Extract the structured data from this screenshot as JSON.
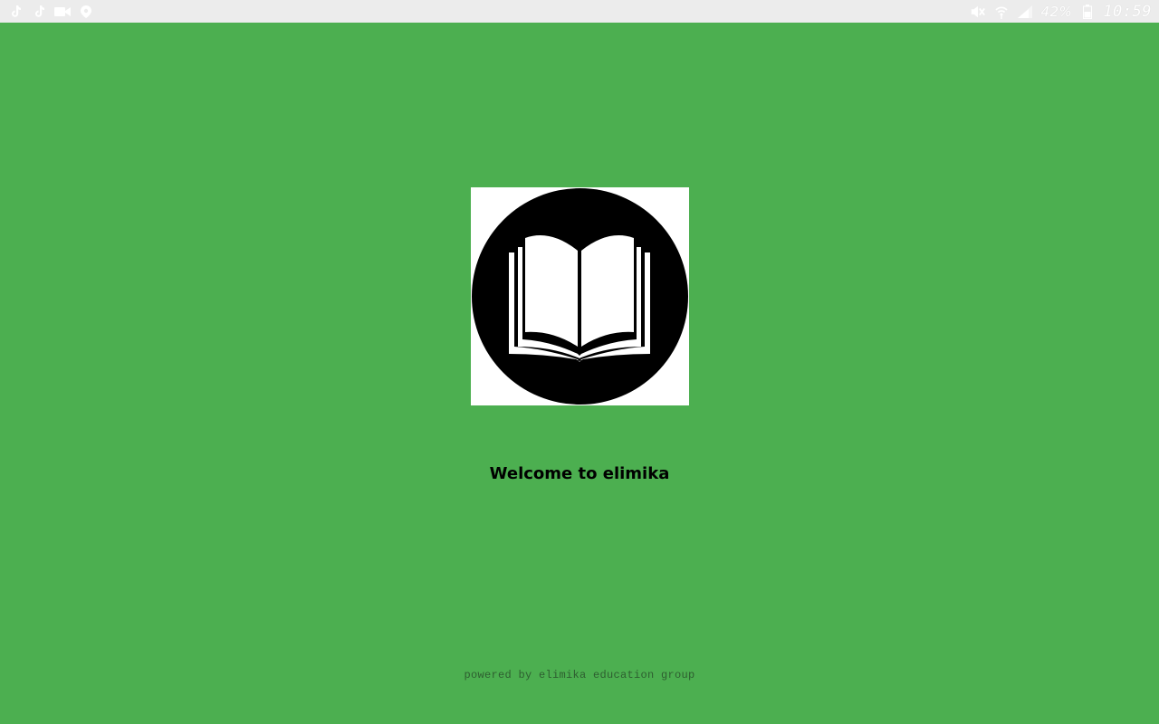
{
  "status_bar": {
    "left_icons": [
      "tiktok-icon",
      "tiktok-icon",
      "video-camera-icon",
      "location-pin-icon"
    ],
    "right_icons": [
      "mute-icon",
      "wifi-icon",
      "signal-icon",
      "battery-icon"
    ],
    "battery_percent": "42%",
    "time": "10:59"
  },
  "splash": {
    "logo_icon": "open-book-icon",
    "welcome_text": "Welcome to elimika",
    "footer_text": "powered by elimika education group"
  },
  "colors": {
    "background": "#4caf50",
    "status_bar_bg": "#ececec",
    "logo_circle": "#000000",
    "logo_book": "#ffffff",
    "footer_text": "#2e5e30"
  }
}
